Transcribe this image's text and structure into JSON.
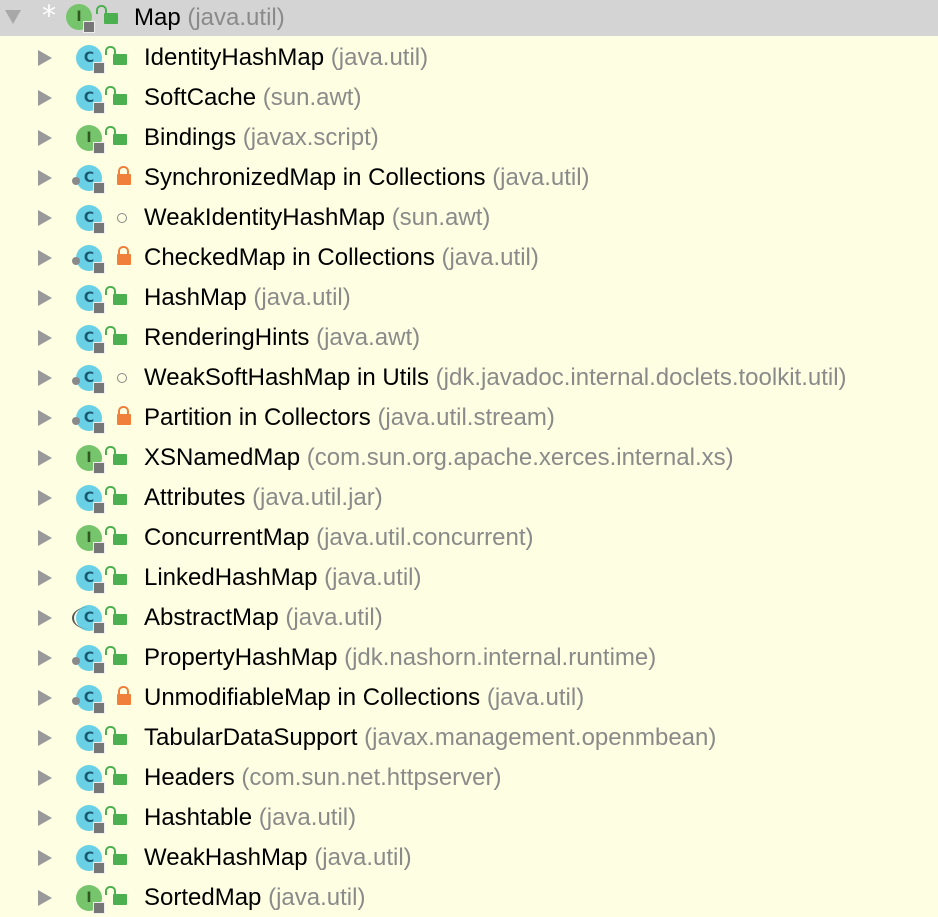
{
  "root": {
    "name": "Map",
    "package": "(java.util)",
    "kind": "I",
    "access": "public"
  },
  "items": [
    {
      "name": "IdentityHashMap",
      "package": "(java.util)",
      "kind": "C",
      "access": "public"
    },
    {
      "name": "SoftCache",
      "package": "(sun.awt)",
      "kind": "C",
      "access": "public"
    },
    {
      "name": "Bindings",
      "package": "(javax.script)",
      "kind": "I",
      "access": "public"
    },
    {
      "name": "SynchronizedMap in Collections",
      "package": "(java.util)",
      "kind": "C",
      "access": "private",
      "modifier": "final"
    },
    {
      "name": "WeakIdentityHashMap",
      "package": "(sun.awt)",
      "kind": "C",
      "access": "package"
    },
    {
      "name": "CheckedMap in Collections",
      "package": "(java.util)",
      "kind": "C",
      "access": "private",
      "modifier": "final"
    },
    {
      "name": "HashMap",
      "package": "(java.util)",
      "kind": "C",
      "access": "public"
    },
    {
      "name": "RenderingHints",
      "package": "(java.awt)",
      "kind": "C",
      "access": "public"
    },
    {
      "name": "WeakSoftHashMap in Utils",
      "package": "(jdk.javadoc.internal.doclets.toolkit.util)",
      "kind": "C",
      "access": "package",
      "modifier": "final"
    },
    {
      "name": "Partition in Collectors",
      "package": "(java.util.stream)",
      "kind": "C",
      "access": "private",
      "modifier": "final"
    },
    {
      "name": "XSNamedMap",
      "package": "(com.sun.org.apache.xerces.internal.xs)",
      "kind": "I",
      "access": "public"
    },
    {
      "name": "Attributes",
      "package": "(java.util.jar)",
      "kind": "C",
      "access": "public"
    },
    {
      "name": "ConcurrentMap",
      "package": "(java.util.concurrent)",
      "kind": "I",
      "access": "public"
    },
    {
      "name": "LinkedHashMap",
      "package": "(java.util)",
      "kind": "C",
      "access": "public"
    },
    {
      "name": "AbstractMap",
      "package": "(java.util)",
      "kind": "C",
      "access": "public",
      "modifier": "abstract"
    },
    {
      "name": "PropertyHashMap",
      "package": "(jdk.nashorn.internal.runtime)",
      "kind": "C",
      "access": "public",
      "modifier": "final"
    },
    {
      "name": "UnmodifiableMap in Collections",
      "package": "(java.util)",
      "kind": "C",
      "access": "private",
      "modifier": "final"
    },
    {
      "name": "TabularDataSupport",
      "package": "(javax.management.openmbean)",
      "kind": "C",
      "access": "public"
    },
    {
      "name": "Headers",
      "package": "(com.sun.net.httpserver)",
      "kind": "C",
      "access": "public"
    },
    {
      "name": "Hashtable",
      "package": "(java.util)",
      "kind": "C",
      "access": "public"
    },
    {
      "name": "WeakHashMap",
      "package": "(java.util)",
      "kind": "C",
      "access": "public"
    },
    {
      "name": "SortedMap",
      "package": "(java.util)",
      "kind": "I",
      "access": "public"
    }
  ],
  "icons": {
    "expand": "triangle-right-icon",
    "collapse": "triangle-down-icon",
    "class": "class-icon",
    "interface": "interface-icon",
    "public": "unlock-icon",
    "private": "lock-icon",
    "package": "circle-icon"
  },
  "colors": {
    "background": "#fefee2",
    "root_row": "#d4d4d4",
    "class_badge": "#6ad0e6",
    "interface_badge": "#76c46c",
    "public_lock": "#4caf50",
    "private_lock": "#ef7f3a",
    "package_text": "#8a8a8a"
  }
}
